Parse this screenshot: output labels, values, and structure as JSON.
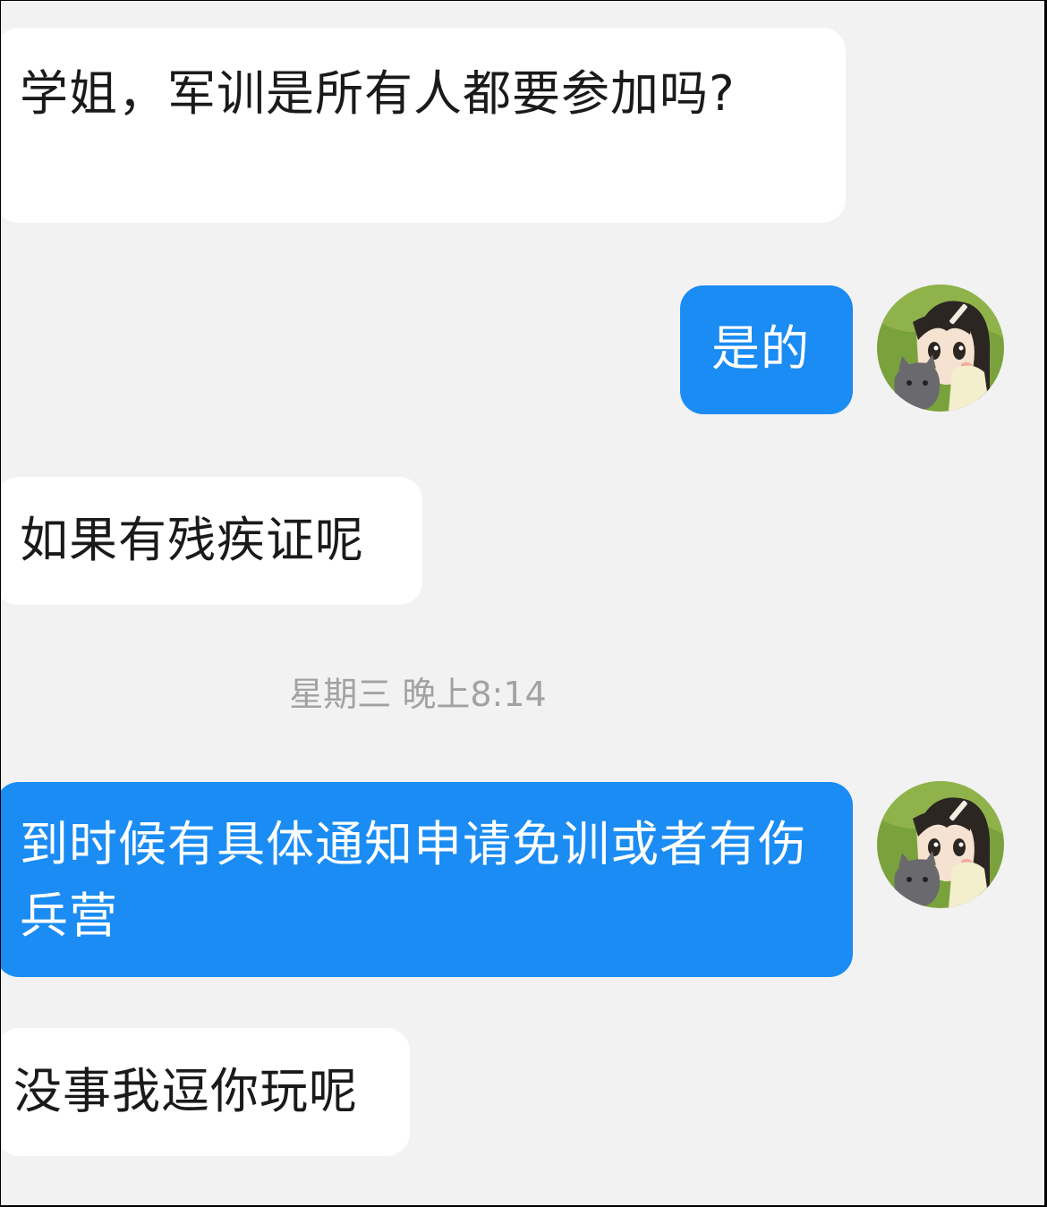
{
  "messages": [
    {
      "direction": "incoming",
      "text": "学姐，军训是所有人都要参加吗?"
    },
    {
      "direction": "outgoing",
      "text": "是的"
    },
    {
      "direction": "incoming",
      "text": "如果有残疾证呢"
    },
    {
      "direction": "outgoing",
      "text": "到时候有具体通知申请免训或者有伤兵营"
    },
    {
      "direction": "incoming",
      "text": "没事我逗你玩呢"
    }
  ],
  "timestamp": "星期三 晚上8:14",
  "avatar": {
    "icon": "anime-girl-with-cat-avatar-icon"
  },
  "colors": {
    "background": "#f2f2f2",
    "incoming_bubble": "#ffffff",
    "outgoing_bubble": "#1a8cf3",
    "timestamp_text": "#a2a2a2"
  }
}
